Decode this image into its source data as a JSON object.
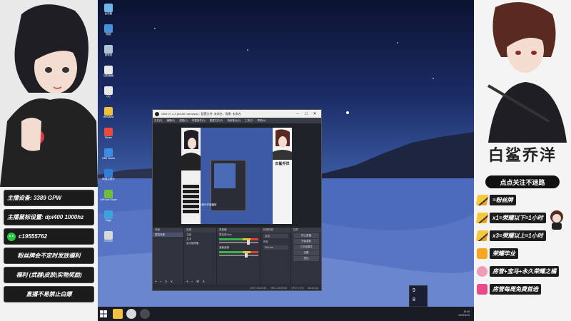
{
  "left_panel": {
    "specs": [
      {
        "label": "主播设备: 3389 GPW"
      },
      {
        "label": "主播鼠标设置: dpi400 1000hz"
      },
      {
        "label": "c19555762",
        "icon": "wechat-icon"
      },
      {
        "label": "粉丝牌会不定时发放福利"
      },
      {
        "label": "福利 (武器|皮肤|实物奖励)"
      },
      {
        "label": "直播不易禁止白嫖"
      }
    ]
  },
  "right_panel": {
    "brand": "白鲨乔洋",
    "follow": "点点关注不迷路",
    "benefits": [
      {
        "icon": "pencil-icon",
        "text": "=粉丝牌"
      },
      {
        "icon": "pencil-icon",
        "text": "x1=荣耀以下=1小时"
      },
      {
        "icon": "pencil-icon",
        "text": "x3=荣耀以上=1小时"
      },
      {
        "icon": "crown-icon",
        "text": "荣耀毕业"
      },
      {
        "icon": "pig-icon",
        "text": "房管+宝马+永久荣耀之橘"
      },
      {
        "icon": "gift-icon",
        "text": "房管每周免费首选"
      }
    ]
  },
  "desktop": {
    "icons": [
      {
        "label": "此电脑",
        "color": "#6fb4ea"
      },
      {
        "label": "网络",
        "color": "#4a90d9"
      },
      {
        "label": "回收站",
        "color": "#b0c4d8"
      },
      {
        "label": "控制面板",
        "color": "#e8e8e8"
      },
      {
        "label": "QQ",
        "color": "#e8e8e8"
      },
      {
        "label": "WeGame",
        "color": "#f0c040"
      },
      {
        "label": "Steam",
        "color": "#e74c3c"
      },
      {
        "label": "OBS Studio",
        "color": "#3c8ee0"
      },
      {
        "label": "网易云音乐",
        "color": "#2f7fd6"
      },
      {
        "label": "GeForce Experience",
        "color": "#6fbf3a"
      },
      {
        "label": "Edge",
        "color": "#3ca4dd"
      },
      {
        "label": "Chrome",
        "color": "#d9d9d9"
      }
    ]
  },
  "obs": {
    "title": "OBS 27.1.3 (64-bit, windows) - 配置文件: 未命名 - 场景: 未命名",
    "menu": [
      "文件(F)",
      "编辑(E)",
      "视图(V)",
      "停靠部件(D)",
      "配置文件(P)",
      "场景集合(S)",
      "工具(T)",
      "帮助(H)"
    ],
    "preview_caption": "让音乐开始播放",
    "preview_brand": "白鲨乔洋",
    "docks": {
      "scenes_header": "场景",
      "scenes": [
        "屏幕采集"
      ],
      "sources_header": "来源",
      "sources": [
        "立绘",
        "文字",
        "显示器采集"
      ],
      "mixer_header": "混音器",
      "mixer": [
        {
          "name": "麦克风/Aux",
          "level": 0.62
        },
        {
          "name": "桌面音频",
          "level": 0.55
        }
      ],
      "transitions_header": "转场特效",
      "transition_type": "淡出",
      "duration_label": "时长",
      "duration": "300 ms",
      "controls_header": "控件",
      "controls": [
        "停止直播",
        "开始录制",
        "工作室模式",
        "设置",
        "退出"
      ]
    },
    "status": [
      "LIVE: 00:15:32",
      "REC: 00:00:00",
      "CPU: 3.2%",
      "60.00 fps"
    ]
  },
  "widget": {
    "top": "9",
    "bottom": "8"
  },
  "taskbar": {
    "time": "16:40",
    "date": "2022/4/19",
    "apps": [
      {
        "name": "file-explorer-icon",
        "color": "#f0c040"
      },
      {
        "name": "chrome-icon",
        "color": "#d9d9d9"
      },
      {
        "name": "obs-icon",
        "color": "#4a4a4a"
      }
    ]
  }
}
